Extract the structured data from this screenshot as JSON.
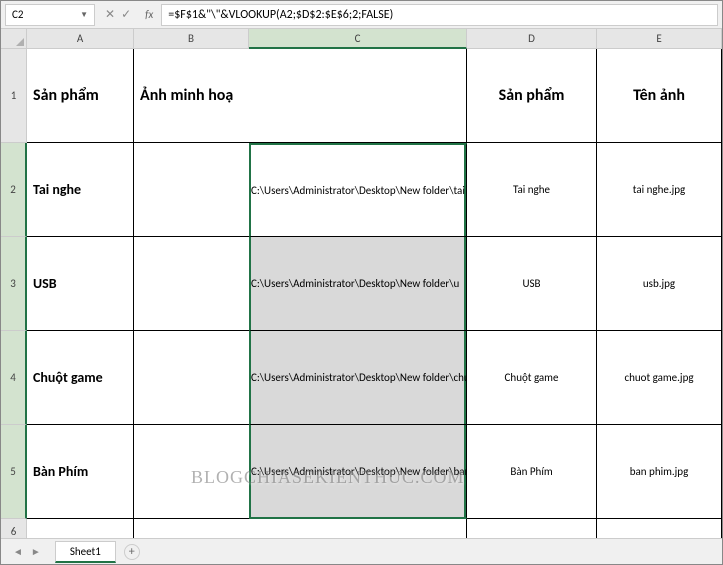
{
  "nameBox": "C2",
  "formula": "=$F$1&\"\\\"&VLOOKUP(A2;$D$2:$E$6;2;FALSE)",
  "cols": {
    "A": "A",
    "B": "B",
    "C": "C",
    "D": "D",
    "E": "E"
  },
  "rowNums": {
    "1": "1",
    "2": "2",
    "3": "3",
    "4": "4",
    "5": "5",
    "6": "6"
  },
  "headers": {
    "A1": "Sản phẩm",
    "B1": "Ảnh minh hoạ",
    "D1": "Sản phẩm",
    "E1": "Tên ảnh"
  },
  "data": {
    "A2": "Tai nghe",
    "C2": "C:\\Users\\Administrator\\Desktop\\New folder\\tai",
    "D2": "Tai nghe",
    "E2": "tai nghe.jpg",
    "A3": "USB",
    "C3": "C:\\Users\\Administrator\\Desktop\\New folder\\u",
    "D3": "USB",
    "E3": "usb.jpg",
    "A4": "Chuột game",
    "C4": "C:\\Users\\Administrator\\Desktop\\New folder\\chuo",
    "D4": "Chuột game",
    "E4": "chuot game.jpg",
    "A5": "Bàn Phím",
    "C5": "C:\\Users\\Administrator\\Desktop\\New folder\\ban",
    "D5": "Bàn Phím",
    "E5": "ban phim.jpg"
  },
  "sheet": "Sheet1",
  "watermark": "BLOGCHIASEKIENTHUC.COM"
}
